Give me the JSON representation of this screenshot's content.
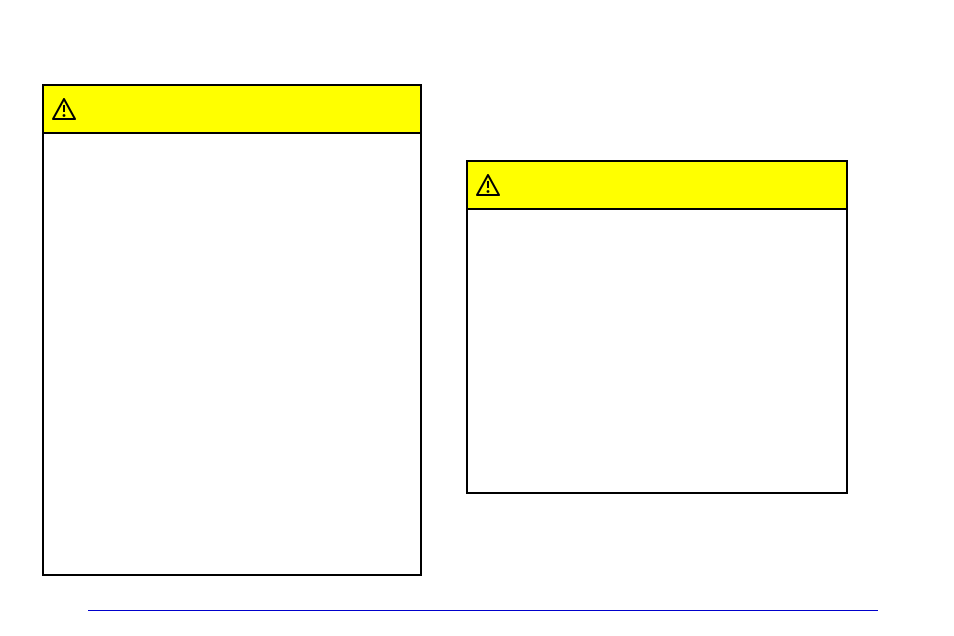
{
  "panel_a": {
    "bullets": [
      "",
      "",
      "",
      "",
      "",
      "",
      "",
      ""
    ],
    "spacer_indices": [
      1,
      4,
      6,
      7
    ]
  },
  "panel_b": {
    "body": ""
  },
  "icons": {
    "a": "warning-icon",
    "b": "warning-icon"
  },
  "footer": {
    "text": ""
  }
}
